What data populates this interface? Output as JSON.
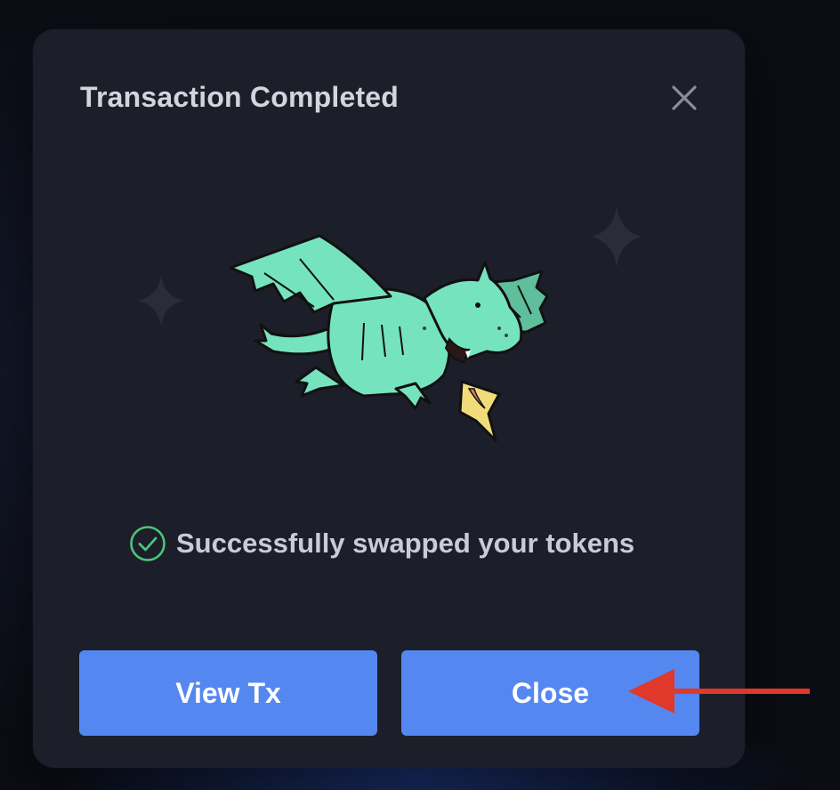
{
  "modal": {
    "title": "Transaction Completed",
    "status_message": "Successfully swapped your tokens",
    "view_tx_label": "View Tx",
    "close_label": "Close"
  },
  "icons": {
    "close": "close-icon",
    "status": "check-circle-icon",
    "illustration": "dragon-illustration",
    "annotation": "red-arrow-annotation"
  },
  "colors": {
    "modal_bg": "#1c1e29",
    "button_bg": "#5587f1",
    "success": "#4cc47b",
    "dragon": "#76e3bf",
    "annotation_arrow": "#e0382a"
  }
}
